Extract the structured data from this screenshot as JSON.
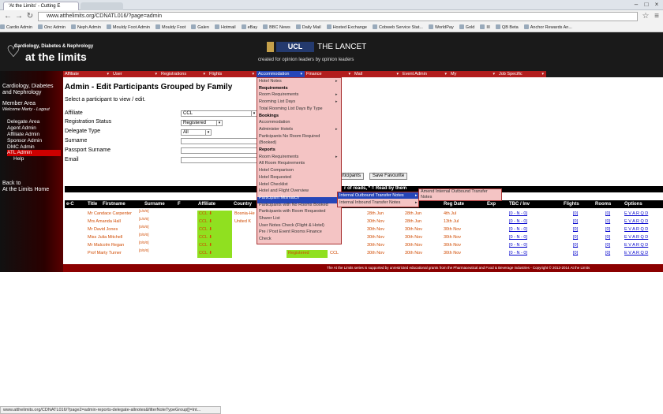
{
  "browser": {
    "tab_title": "'At the Limits' - Cutting E",
    "tab2_title": "",
    "url": "www.atthelimits.org/CDNATL016/?page=admin",
    "bookmarks": [
      "Cardio Admin",
      "Onc Admin",
      "Neph Admin",
      "Mouldy Foot Admin",
      "Mouldy Foot",
      "Galen",
      "Hotmail",
      "eBay",
      "BBC News",
      "Daily Mail",
      "Hosted Exchange",
      "Cobweb Service Stat...",
      "WorldPay",
      "Gold",
      "III",
      "QB Beta",
      "Anchor Rewards An..."
    ],
    "status_url": "www.atthelimits.org/CDNATL016/?page2=admin-reports-delegate-allnotes&filterNoteTypeGroup[]=Int..."
  },
  "header": {
    "logo_sub": "Cardiology, Diabetes & Nephrology",
    "logo_main": "at the limits",
    "ucl": "UCL",
    "lancet": "THE LANCET",
    "tagline": "created for opinion leaders by opinion leaders"
  },
  "menu": [
    "Affiliate",
    "User",
    "Registrations",
    "Flights",
    "Accommodation",
    "Finance",
    "Mail",
    "Event Admin",
    "My",
    "Job Specific"
  ],
  "sidebar": {
    "title1": "Cardiology, Diabetes",
    "title2": "and Nephrology",
    "member": "Member Area",
    "welcome": "Welcome Marty - Logout",
    "items": [
      "Delegate Area",
      "Agent Admin",
      "Affiliate Admin",
      "Sponsor Admin",
      "DMC Admin",
      "ATL Admin",
      "Help"
    ],
    "back1": "Back to",
    "back2": "At the Limits Home"
  },
  "main": {
    "title": "Admin - Edit Participants Grouped by Family",
    "instruction": "Select a participant to view / edit.",
    "fields": {
      "affiliate_label": "Affiliate",
      "affiliate_value": "CCL",
      "status_label": "Registration Status",
      "status_value": "Registered",
      "type_label": "Delegate Type",
      "type_value": "All",
      "surname_label": "Surname",
      "passport_label": "Passport Surname",
      "email_label": "Email"
    },
    "buttons": {
      "participants": "articipants",
      "favourite": "Save Favourite"
    },
    "legend": "r of reads, * = Read by them"
  },
  "table": {
    "headers": [
      "e-C",
      "Title",
      "Firstname",
      "Surname",
      "F",
      "Affiliate",
      "Country",
      "",
      "",
      "Reg Date",
      "TBC / Inv",
      "Exp",
      "Flights",
      "Rooms",
      "Options"
    ],
    "rows": [
      {
        "name": "Mr Candace Carpenter",
        "rt": "[1/0/0]",
        "aff": "CCL",
        "country": "Bosnia-He",
        "d1": "28th Jun",
        "d2": "28th Jun",
        "reg": "4th Jul",
        "tbc": "[0 - N - 0]",
        "fl": "[0]",
        "rm": "[0]",
        "opt": "E V A R Q D"
      },
      {
        "name": "Mrs Amanda Hall",
        "rt": "[1/0/0]",
        "aff": "CCL",
        "country": "United K",
        "d1": "30th Nov",
        "d2": "28th Jun",
        "reg": "13th Jul",
        "tbc": "[0 - N - 0]",
        "fl": "[0]",
        "rm": "[0]",
        "opt": "E V A R Q D"
      },
      {
        "name": "Mr David Jones",
        "rt": "[0/0/0]",
        "aff": "CCL",
        "country": "",
        "d1": "30th Nov",
        "d2": "30th Nov",
        "reg": "30th Nov",
        "tbc": "[0 - N - 0]",
        "fl": "[0]",
        "rm": "[0]",
        "opt": "E V A R Q D"
      },
      {
        "name": "Miss Julia Mitchell",
        "rt": "[0/0/0]",
        "aff": "CCL",
        "country": "",
        "d1": "30th Nov",
        "d2": "30th Nov",
        "reg": "30th Nov",
        "tbc": "[0 - N - 0]",
        "fl": "[0]",
        "rm": "[0]",
        "opt": "E V A R Q D"
      },
      {
        "name": "Mr Malcolm Regan",
        "rt": "[0/0/0]",
        "aff": "CCL",
        "country": "",
        "d1": "30th Nov",
        "d2": "30th Nov",
        "reg": "30th Nov",
        "tbc": "[0 - N - 0]",
        "fl": "[0]",
        "rm": "[0]",
        "opt": "E V A R Q D"
      },
      {
        "name": "Prof Marty Turner",
        "rt": "[0/0/0]",
        "aff": "CCL",
        "country": "",
        "status": "Registered",
        "aff2": "CCL",
        "d1": "30th Nov",
        "d2": "30th Nov",
        "reg": "30th Nov",
        "tbc": "[0 - N - 0]",
        "fl": "[0]",
        "rm": "[0]",
        "opt": "E V A R Q D"
      }
    ]
  },
  "dropdown_accommodation": [
    {
      "label": "Hotel Notes",
      "arrow": true
    },
    {
      "label": "Requirements",
      "head": true
    },
    {
      "label": "Room Requirements",
      "arrow": true
    },
    {
      "label": "Rooming List Days",
      "arrow": true
    },
    {
      "label": "Total Rooming List Days By Type"
    },
    {
      "label": "Bookings",
      "head": true
    },
    {
      "label": "Accommodation"
    },
    {
      "label": "Administer Hotels",
      "arrow": true
    },
    {
      "label": "Participants No Room Required"
    },
    {
      "label": "(Booked)"
    },
    {
      "label": "Reports",
      "head": true
    },
    {
      "label": "Room Requirements",
      "arrow": true
    },
    {
      "label": "All Room Requirements"
    },
    {
      "label": "Hotel Comparison"
    },
    {
      "label": "Hotel Requested"
    },
    {
      "label": "Hotel Checklist"
    },
    {
      "label": "Hotel and Flight Overview"
    },
    {
      "label": "Participant Mismatch"
    },
    {
      "label": "Participants with No Rooms Booked"
    },
    {
      "label": "Participants with Room Requested"
    },
    {
      "label": "Sharer List"
    },
    {
      "label": "User Notes Check (Flight & Hotel)"
    },
    {
      "label": "Pre / Post Event Rooms Finance"
    },
    {
      "label": "Check"
    }
  ],
  "dropdown_notes": [
    {
      "label": "Internal Outbound Transfer Notes",
      "arrow": true
    },
    {
      "label": "Internal Inbound Transfer Notes",
      "arrow": true
    }
  ],
  "dropdown_sub": [
    "Amend Internal Outbound Transfer",
    "Notes"
  ],
  "footer": "The At the Limits series is supported by unrestricted educational grants from the Pharmaceutical and Food & Beverage industries - Copyright © 2013-2014 At the Limits",
  "colors": {
    "menu_red": "#b21d1d",
    "highlight": "#2646b8",
    "dropdown_bg": "#f4c4c4",
    "affiliate_green": "#90e020",
    "link_orange": "#d04a00"
  }
}
